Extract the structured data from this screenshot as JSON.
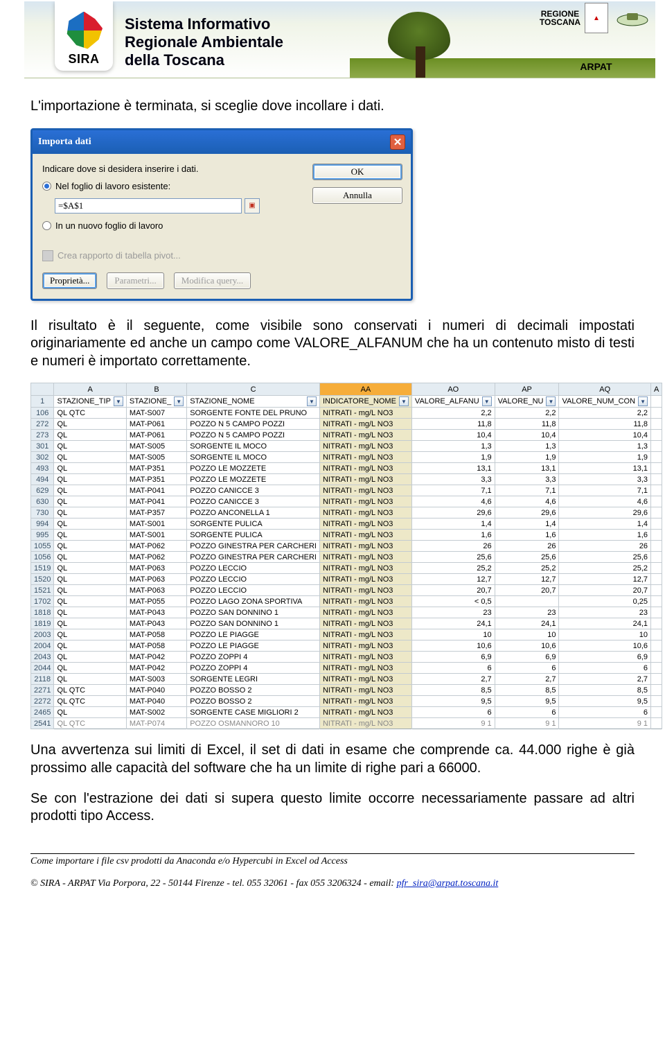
{
  "banner": {
    "sira": "SIRA",
    "title_l1": "Sistema Informativo",
    "title_l2": "Regionale Ambientale",
    "title_l3": "della Toscana",
    "regione_label": "REGIONE\nTOSCANA",
    "arpat_label": "ARPAT"
  },
  "doc": {
    "para1": "L'importazione è terminata, si sceglie dove incollare i dati.",
    "para2": "Il risultato è il seguente, come visibile sono conservati i numeri di decimali impostati originariamente ed anche un campo come VALORE_ALFANUM che ha un contenuto misto di testi e numeri è importato correttamente.",
    "para3": "Una avvertenza sui limiti di Excel, il set di dati in esame che comprende ca. 44.000 righe è già prossimo alle capacità del software che ha un limite di righe pari a 66000.",
    "para4": "Se con l'estrazione dei dati si supera questo limite occorre necessariamente passare ad altri prodotti tipo Access."
  },
  "dialog": {
    "title": "Importa dati",
    "instruction": "Indicare dove si desidera inserire i dati.",
    "radio1": "Nel foglio di lavoro esistente:",
    "cellref": "=$A$1",
    "radio2": "In un nuovo foglio di lavoro",
    "pivot_link": "Crea rapporto di tabella pivot...",
    "btn_ok": "OK",
    "btn_cancel": "Annulla",
    "btn_props": "Proprietà...",
    "btn_params": "Parametri...",
    "btn_edit": "Modifica query..."
  },
  "excel": {
    "col_letters": [
      "A",
      "B",
      "C",
      "AA",
      "AO",
      "AP",
      "AQ",
      "A"
    ],
    "headers": [
      "STAZIONE_TIP",
      "STAZIONE_",
      "STAZIONE_NOME",
      "INDICATORE_NOME",
      "VALORE_ALFANU",
      "VALORE_NU",
      "VALORE_NUM_CON"
    ],
    "rows": [
      {
        "n": "106",
        "a": "QL QTC",
        "b": "MAT-S007",
        "c": "SORGENTE FONTE DEL PRUNO",
        "aa": "NITRATI - mg/L NO3",
        "ao": "2,2",
        "ap": "2,2",
        "aq": "2,2"
      },
      {
        "n": "272",
        "a": "QL",
        "b": "MAT-P061",
        "c": "POZZO N 5 CAMPO POZZI",
        "aa": "NITRATI - mg/L NO3",
        "ao": "11,8",
        "ap": "11,8",
        "aq": "11,8"
      },
      {
        "n": "273",
        "a": "QL",
        "b": "MAT-P061",
        "c": "POZZO N 5 CAMPO POZZI",
        "aa": "NITRATI - mg/L NO3",
        "ao": "10,4",
        "ap": "10,4",
        "aq": "10,4"
      },
      {
        "n": "301",
        "a": "QL",
        "b": "MAT-S005",
        "c": "SORGENTE  IL MOCO",
        "aa": "NITRATI - mg/L NO3",
        "ao": "1,3",
        "ap": "1,3",
        "aq": "1,3"
      },
      {
        "n": "302",
        "a": "QL",
        "b": "MAT-S005",
        "c": "SORGENTE  IL MOCO",
        "aa": "NITRATI - mg/L NO3",
        "ao": "1,9",
        "ap": "1,9",
        "aq": "1,9"
      },
      {
        "n": "493",
        "a": "QL",
        "b": "MAT-P351",
        "c": "POZZO  LE MOZZETE",
        "aa": "NITRATI - mg/L NO3",
        "ao": "13,1",
        "ap": "13,1",
        "aq": "13,1"
      },
      {
        "n": "494",
        "a": "QL",
        "b": "MAT-P351",
        "c": "POZZO  LE MOZZETE",
        "aa": "NITRATI - mg/L NO3",
        "ao": "3,3",
        "ap": "3,3",
        "aq": "3,3"
      },
      {
        "n": "629",
        "a": "QL",
        "b": "MAT-P041",
        "c": "POZZO CANICCE 3",
        "aa": "NITRATI - mg/L NO3",
        "ao": "7,1",
        "ap": "7,1",
        "aq": "7,1"
      },
      {
        "n": "630",
        "a": "QL",
        "b": "MAT-P041",
        "c": "POZZO CANICCE 3",
        "aa": "NITRATI - mg/L NO3",
        "ao": "4,6",
        "ap": "4,6",
        "aq": "4,6"
      },
      {
        "n": "730",
        "a": "QL",
        "b": "MAT-P357",
        "c": "POZZO ANCONELLA 1",
        "aa": "NITRATI - mg/L NO3",
        "ao": "29,6",
        "ap": "29,6",
        "aq": "29,6"
      },
      {
        "n": "994",
        "a": "QL",
        "b": "MAT-S001",
        "c": "SORGENTE PULICA",
        "aa": "NITRATI - mg/L NO3",
        "ao": "1,4",
        "ap": "1,4",
        "aq": "1,4"
      },
      {
        "n": "995",
        "a": "QL",
        "b": "MAT-S001",
        "c": "SORGENTE PULICA",
        "aa": "NITRATI - mg/L NO3",
        "ao": "1,6",
        "ap": "1,6",
        "aq": "1,6"
      },
      {
        "n": "1055",
        "a": "QL",
        "b": "MAT-P062",
        "c": "POZZO GINESTRA  PER CARCHERI",
        "aa": "NITRATI - mg/L NO3",
        "ao": "26",
        "ap": "26",
        "aq": "26"
      },
      {
        "n": "1056",
        "a": "QL",
        "b": "MAT-P062",
        "c": "POZZO GINESTRA  PER CARCHERI",
        "aa": "NITRATI - mg/L NO3",
        "ao": "25,6",
        "ap": "25,6",
        "aq": "25,6"
      },
      {
        "n": "1519",
        "a": "QL",
        "b": "MAT-P063",
        "c": "POZZO LECCIO",
        "aa": "NITRATI - mg/L NO3",
        "ao": "25,2",
        "ap": "25,2",
        "aq": "25,2"
      },
      {
        "n": "1520",
        "a": "QL",
        "b": "MAT-P063",
        "c": "POZZO LECCIO",
        "aa": "NITRATI - mg/L NO3",
        "ao": "12,7",
        "ap": "12,7",
        "aq": "12,7"
      },
      {
        "n": "1521",
        "a": "QL",
        "b": "MAT-P063",
        "c": "POZZO LECCIO",
        "aa": "NITRATI - mg/L NO3",
        "ao": "20,7",
        "ap": "20,7",
        "aq": "20,7"
      },
      {
        "n": "1702",
        "a": "QL",
        "b": "MAT-P055",
        "c": "POZZO LAGO ZONA SPORTIVA",
        "aa": "NITRATI - mg/L NO3",
        "ao": "< 0,5",
        "ap": "",
        "aq": "0,25"
      },
      {
        "n": "1818",
        "a": "QL",
        "b": "MAT-P043",
        "c": "POZZO SAN DONNINO 1",
        "aa": "NITRATI - mg/L NO3",
        "ao": "23",
        "ap": "23",
        "aq": "23"
      },
      {
        "n": "1819",
        "a": "QL",
        "b": "MAT-P043",
        "c": "POZZO SAN DONNINO 1",
        "aa": "NITRATI - mg/L NO3",
        "ao": "24,1",
        "ap": "24,1",
        "aq": "24,1"
      },
      {
        "n": "2003",
        "a": "QL",
        "b": "MAT-P058",
        "c": "POZZO  LE PIAGGE",
        "aa": "NITRATI - mg/L NO3",
        "ao": "10",
        "ap": "10",
        "aq": "10"
      },
      {
        "n": "2004",
        "a": "QL",
        "b": "MAT-P058",
        "c": "POZZO  LE PIAGGE",
        "aa": "NITRATI - mg/L NO3",
        "ao": "10,6",
        "ap": "10,6",
        "aq": "10,6"
      },
      {
        "n": "2043",
        "a": "QL",
        "b": "MAT-P042",
        "c": "POZZO ZOPPI 4",
        "aa": "NITRATI - mg/L NO3",
        "ao": "6,9",
        "ap": "6,9",
        "aq": "6,9"
      },
      {
        "n": "2044",
        "a": "QL",
        "b": "MAT-P042",
        "c": "POZZO ZOPPI 4",
        "aa": "NITRATI - mg/L NO3",
        "ao": "6",
        "ap": "6",
        "aq": "6"
      },
      {
        "n": "2118",
        "a": "QL",
        "b": "MAT-S003",
        "c": "SORGENTE LEGRI",
        "aa": "NITRATI - mg/L NO3",
        "ao": "2,7",
        "ap": "2,7",
        "aq": "2,7"
      },
      {
        "n": "2271",
        "a": "QL QTC",
        "b": "MAT-P040",
        "c": "POZZO BOSSO 2",
        "aa": "NITRATI - mg/L NO3",
        "ao": "8,5",
        "ap": "8,5",
        "aq": "8,5"
      },
      {
        "n": "2272",
        "a": "QL QTC",
        "b": "MAT-P040",
        "c": "POZZO BOSSO 2",
        "aa": "NITRATI - mg/L NO3",
        "ao": "9,5",
        "ap": "9,5",
        "aq": "9,5"
      },
      {
        "n": "2465",
        "a": "QL",
        "b": "MAT-S002",
        "c": "SORGENTE CASE MIGLIORI 2",
        "aa": "NITRATI - mg/L NO3",
        "ao": "6",
        "ap": "6",
        "aq": "6"
      },
      {
        "n": "2541",
        "a": "QL QTC",
        "b": "MAT-P074",
        "c": "POZZO OSMANNORO 10",
        "aa": "NITRATI - mg/L NO3",
        "ao": "9 1",
        "ap": "9 1",
        "aq": "9 1"
      }
    ]
  },
  "footer": {
    "line1": "Come importare i file csv prodotti da Anaconda e/o Hypercubi in Excel od Access",
    "line2_pre": "© SIRA - ARPAT Via Porpora, 22 - 50144 Firenze - tel. 055 32061 - fax 055 3206324 - email: ",
    "line2_link": "pfr_sira@arpat.toscana.it"
  }
}
